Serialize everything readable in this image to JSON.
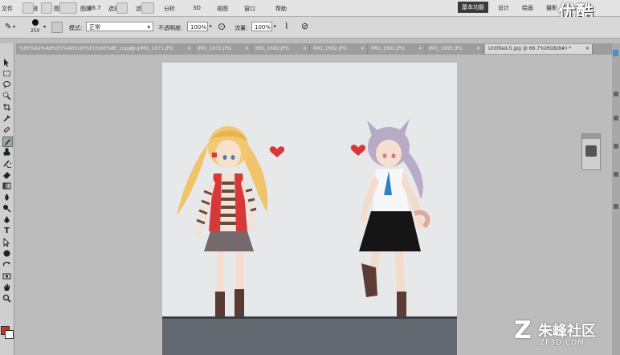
{
  "menu": {
    "items": [
      "文件",
      "编辑",
      "图像",
      "图层",
      "选择",
      "滤镜",
      "分析",
      "3D",
      "视图",
      "窗口",
      "帮助"
    ],
    "zoom_value": "66.7"
  },
  "workspace": {
    "items": [
      "基本功能",
      "设计",
      "绘画",
      "摄影"
    ],
    "active_index": 0
  },
  "options": {
    "brush_size": "250",
    "mode_label": "模式:",
    "mode_value": "正常",
    "opacity_label": "不透明度:",
    "opacity_value": "100%",
    "flow_label": "流量:",
    "flow_value": "100%"
  },
  "tabs": [
    {
      "label": "%E6%A2%A8%E5%AD%90%E5%90%8E_copy.jpg"
    },
    {
      "label": "IMG_1671.JPG"
    },
    {
      "label": "IMG_1672.JPG"
    },
    {
      "label": "IMG_1682.JPG"
    },
    {
      "label": "IMG_1682.JPG"
    },
    {
      "label": "IMG_1691.JPG"
    },
    {
      "label": "IMG_1695.JPG"
    },
    {
      "label": "Untitled-5.jpg @ 66.7%(RGB/8#) *"
    }
  ],
  "colors": {
    "foreground": "#d42d22",
    "background": "#ffffff",
    "heart": "#d93737"
  },
  "watermarks": {
    "top_right": "优酷",
    "bottom_right": "朱峰社区",
    "bottom_right_sub": "ZF3D.COM"
  }
}
